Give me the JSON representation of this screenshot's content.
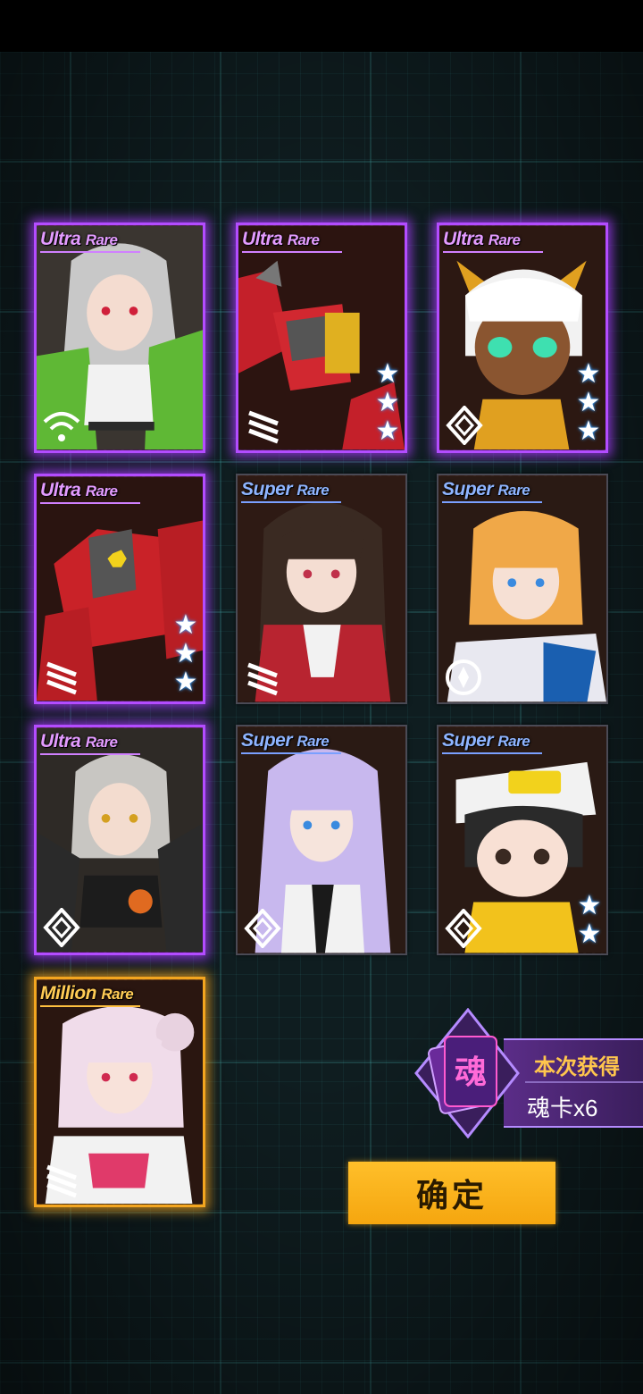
{
  "cards": [
    {
      "rarity_main": "Ultra",
      "rarity_sub": "Rare",
      "tier": "ultra",
      "stars": 0,
      "class_icon": "wifi-icon"
    },
    {
      "rarity_main": "Ultra",
      "rarity_sub": "Rare",
      "tier": "ultra",
      "stars": 3,
      "class_icon": "claw-icon"
    },
    {
      "rarity_main": "Ultra",
      "rarity_sub": "Rare",
      "tier": "ultra",
      "stars": 3,
      "class_icon": "diamond-icon"
    },
    {
      "rarity_main": "Ultra",
      "rarity_sub": "Rare",
      "tier": "ultra",
      "stars": 3,
      "class_icon": "claw-icon"
    },
    {
      "rarity_main": "Super",
      "rarity_sub": "Rare",
      "tier": "super",
      "stars": 0,
      "class_icon": "claw-icon"
    },
    {
      "rarity_main": "Super",
      "rarity_sub": "Rare",
      "tier": "super",
      "stars": 0,
      "class_icon": "compass-icon"
    },
    {
      "rarity_main": "Ultra",
      "rarity_sub": "Rare",
      "tier": "ultra",
      "stars": 0,
      "class_icon": "diamond-icon"
    },
    {
      "rarity_main": "Super",
      "rarity_sub": "Rare",
      "tier": "super",
      "stars": 0,
      "class_icon": "diamond-icon"
    },
    {
      "rarity_main": "Super",
      "rarity_sub": "Rare",
      "tier": "super",
      "stars": 2,
      "class_icon": "diamond-icon"
    },
    {
      "rarity_main": "Million",
      "rarity_sub": "Rare",
      "tier": "million",
      "stars": 0,
      "class_icon": "claw-icon"
    }
  ],
  "soul_reward": {
    "icon_char": "魂",
    "title": "本次获得",
    "count_text": "魂卡x6"
  },
  "confirm_button": {
    "label": "确定"
  },
  "colors": {
    "ultra_glow": "#b34cff",
    "super_border": "#4a4a55",
    "million_glow": "#f3a51f",
    "confirm_bg": "#f5a60f",
    "reward_title": "#ffc64d"
  }
}
